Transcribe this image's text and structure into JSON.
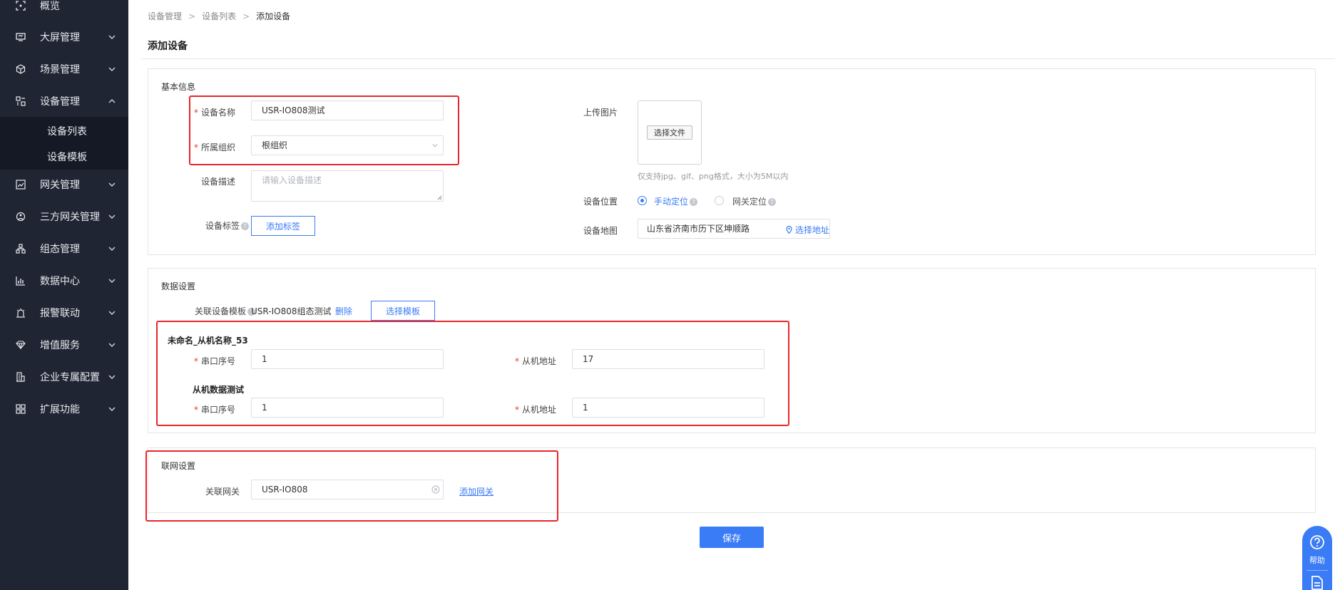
{
  "sidebar": {
    "items": [
      {
        "label": "概览",
        "icon": "overview-icon"
      },
      {
        "label": "大屏管理",
        "icon": "screen-icon"
      },
      {
        "label": "场景管理",
        "icon": "cube-icon"
      },
      {
        "label": "设备管理",
        "icon": "device-icon"
      },
      {
        "label": "网关管理",
        "icon": "gateway-icon"
      },
      {
        "label": "三方网关管理",
        "icon": "network-icon"
      },
      {
        "label": "组态管理",
        "icon": "topology-icon"
      },
      {
        "label": "数据中心",
        "icon": "chart-icon"
      },
      {
        "label": "报警联动",
        "icon": "alarm-icon"
      },
      {
        "label": "增值服务",
        "icon": "diamond-icon"
      },
      {
        "label": "企业专属配置",
        "icon": "building-icon"
      },
      {
        "label": "扩展功能",
        "icon": "grid-icon"
      }
    ],
    "sub_items": [
      "设备列表",
      "设备模板"
    ]
  },
  "breadcrumb": [
    "设备管理",
    "设备列表",
    "添加设备"
  ],
  "page_title": "添加设备",
  "basic": {
    "title": "基本信息",
    "name_label": "设备名称",
    "name_value": "USR-IO808测试",
    "org_label": "所属组织",
    "org_value": "根组织",
    "desc_label": "设备描述",
    "desc_placeholder": "请输入设备描述",
    "tag_label": "设备标签",
    "tag_button": "添加标签",
    "upload_label": "上传图片",
    "upload_button": "选择文件",
    "upload_hint": "仅支持jpg、gif、png格式，大小为5M以内",
    "location_label": "设备位置",
    "location_manual": "手动定位",
    "location_gateway": "网关定位",
    "map_label": "设备地图",
    "map_value": "山东省济南市历下区坤顺路",
    "map_select": "选择地址"
  },
  "data_settings": {
    "title": "数据设置",
    "template_label": "关联设备模板",
    "template_value": "USR-IO808组态测试",
    "delete_link": "删除",
    "select_template_button": "选择模板",
    "groups": [
      {
        "name": "未命名_从机名称_53",
        "port_label": "串口序号",
        "port_value": "1",
        "addr_label": "从机地址",
        "addr_value": "17"
      },
      {
        "name": "从机数据测试",
        "port_label": "串口序号",
        "port_value": "1",
        "addr_label": "从机地址",
        "addr_value": "1"
      }
    ]
  },
  "network": {
    "title": "联网设置",
    "gateway_label": "关联网关",
    "gateway_value": "USR-IO808",
    "add_gateway_link": "添加网关"
  },
  "save_button": "保存",
  "help_label": "帮助",
  "colors": {
    "accent": "#3a7bf6",
    "sidebar": "#1f2532",
    "highlight": "#e8262b"
  }
}
